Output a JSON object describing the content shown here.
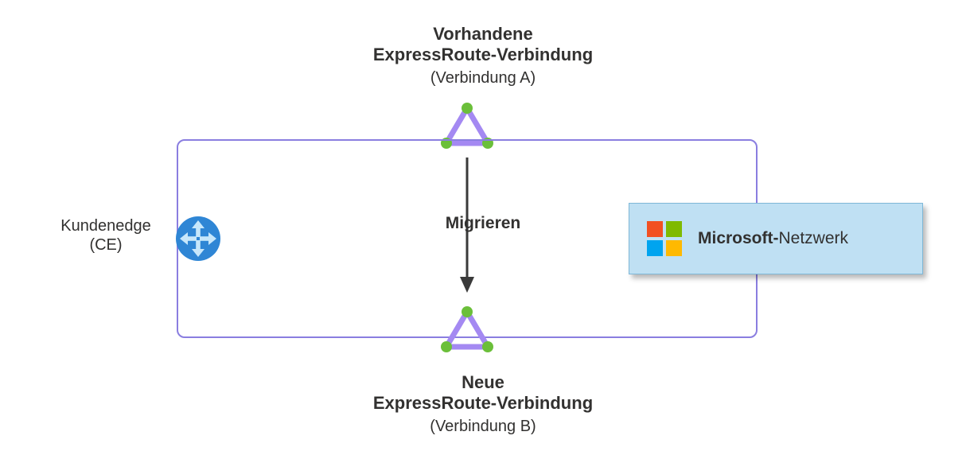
{
  "top": {
    "title_line1": "Vorhandene",
    "title_line2": "ExpressRoute-Verbindung",
    "subtitle": "(Verbindung A)"
  },
  "bottom": {
    "title_line1": "Neue",
    "title_line2": "ExpressRoute-Verbindung",
    "subtitle": "(Verbindung B)"
  },
  "migrate_label": "Migrieren",
  "customer_edge": {
    "line1": "Kundenedge",
    "line2": "(CE)"
  },
  "microsoft_box": {
    "bold": "Microsoft-",
    "rest": "Netzwerk"
  },
  "colors": {
    "triangle": "#a489f2",
    "dot": "#6bbf3a",
    "frame": "#8a7ee0",
    "router_circle": "#2f86d5",
    "router_arrow": "#c7e7fb",
    "ms_box_bg": "#bfe0f3",
    "arrow": "#3a3a3a"
  }
}
